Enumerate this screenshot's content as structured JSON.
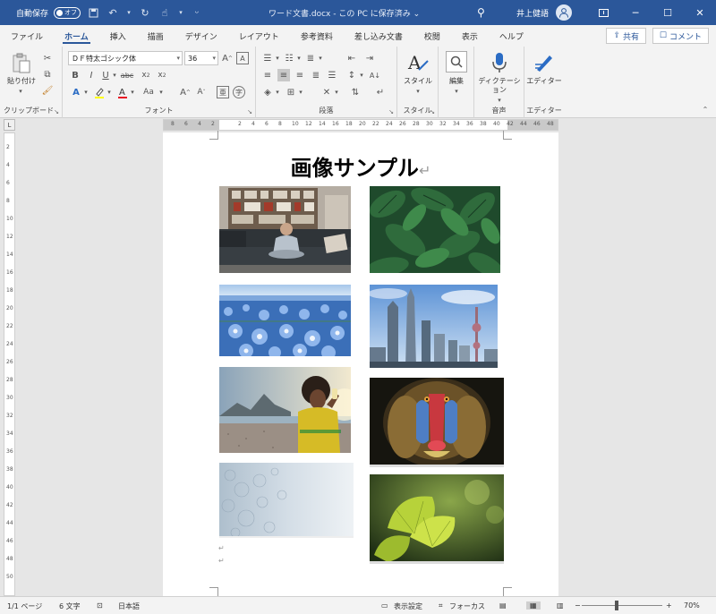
{
  "titlebar": {
    "autosave_label": "自動保存",
    "autosave_state": "オフ",
    "doc_title": "ワード文書.docx - この PC に保存済み ⌄",
    "user_name": "井上健語",
    "qat_icons": [
      "save-icon",
      "undo-icon",
      "redo-icon",
      "touch-mode-icon",
      "customize-icon"
    ]
  },
  "tabs": [
    "ファイル",
    "ホーム",
    "挿入",
    "描画",
    "デザイン",
    "レイアウト",
    "参考資料",
    "差し込み文書",
    "校閲",
    "表示",
    "ヘルプ"
  ],
  "share": {
    "label": "共有"
  },
  "comment": {
    "label": "コメント"
  },
  "ribbon": {
    "clipboard": {
      "label": "クリップボード",
      "paste": "貼り付け"
    },
    "font": {
      "label": "フォント",
      "font_name": "ＤＦ特太ゴシック体",
      "font_size": "36",
      "change_case": "Aa"
    },
    "paragraph": {
      "label": "段落"
    },
    "styles": {
      "label": "スタイル",
      "button": "スタイル"
    },
    "editing": {
      "button": "編集"
    },
    "voice": {
      "label": "音声",
      "button": "ディクテーション"
    },
    "editor": {
      "label": "エディター",
      "button": "エディター"
    }
  },
  "ruler": {
    "top": [
      "8",
      "6",
      "4",
      "2",
      "",
      "2",
      "4",
      "6",
      "8",
      "10",
      "12",
      "14",
      "16",
      "18",
      "20",
      "22",
      "24",
      "26",
      "28",
      "30",
      "32",
      "34",
      "36",
      "38",
      "40",
      "42",
      "44",
      "46",
      "48"
    ],
    "left": [
      "2",
      "4",
      "6",
      "8",
      "10",
      "12",
      "14",
      "16",
      "18",
      "20",
      "22",
      "24",
      "26",
      "28",
      "30",
      "32",
      "34",
      "36",
      "38",
      "40",
      "42",
      "44",
      "46",
      "48",
      "50"
    ]
  },
  "document": {
    "title": "画像サンプル",
    "photos": [
      {
        "name": "photo-meditation-living-room",
        "desc": "sofa"
      },
      {
        "name": "photo-green-leaves",
        "desc": "leaves"
      },
      {
        "name": "photo-blue-flowers",
        "desc": "flowers"
      },
      {
        "name": "photo-shanghai-skyline",
        "desc": "city"
      },
      {
        "name": "photo-man-drinking-beach",
        "desc": "beach"
      },
      {
        "name": "photo-mandrill",
        "desc": "mandrill"
      },
      {
        "name": "photo-frost-pattern",
        "desc": "frost"
      },
      {
        "name": "photo-ginkgo-leaves",
        "desc": "ginkgo"
      }
    ]
  },
  "statusbar": {
    "page": "1/1 ページ",
    "words": "6 文字",
    "language": "日本語",
    "display_settings": "表示設定",
    "focus": "フォーカス",
    "zoom": "70%"
  },
  "colors": {
    "titlebar": "#2b579a",
    "accent": "#2b579a"
  }
}
